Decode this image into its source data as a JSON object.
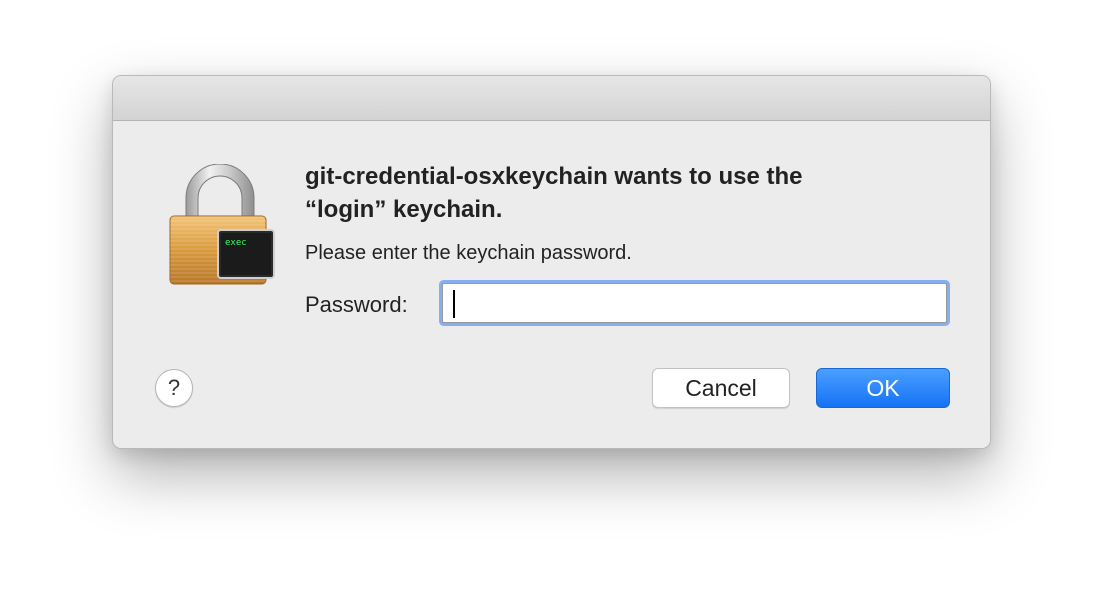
{
  "dialog": {
    "heading_line1": "git-credential-osxkeychain wants to use the",
    "heading_line2": "“login” keychain.",
    "message": "Please enter the keychain password.",
    "password_label": "Password:",
    "password_value": "",
    "icon_badge_text": "exec"
  },
  "buttons": {
    "help_label": "?",
    "cancel_label": "Cancel",
    "ok_label": "OK"
  },
  "colors": {
    "accent": "#1572f5",
    "focus_ring": "#86aef2",
    "lock_gold": "#d99a3d",
    "terminal_text": "#33ff66"
  },
  "icons": {
    "app_icon": "padlock-with-terminal-icon"
  }
}
